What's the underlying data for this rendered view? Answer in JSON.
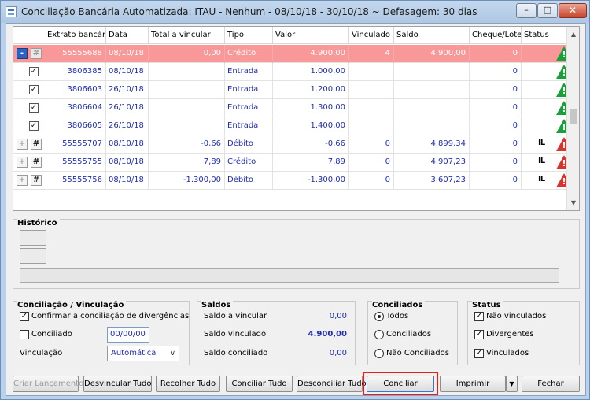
{
  "window": {
    "title": "Conciliação Bancária Automatizada: ITAU - Nenhum - 08/10/18 - 30/10/18 ~ Defasagem: 30 dias",
    "minimize": "–",
    "maximize": "□",
    "close": "✕"
  },
  "grid": {
    "columns": [
      "Extrato bancário",
      "Data",
      "Total a vincular",
      "Tipo",
      "Valor",
      "Vinculado",
      "Saldo",
      "Cheque/Lote",
      "Status"
    ],
    "rows": [
      {
        "extrato": "55555688",
        "data": "08/10/18",
        "total": "0,00",
        "tipo": "Crédito",
        "valor": "4.900,00",
        "vinculado": "4",
        "saldo": "4.900,00",
        "cheque": "0",
        "status": "ok"
      },
      {
        "extrato": "3806385",
        "data": "08/10/18",
        "total": "",
        "tipo": "Entrada",
        "valor": "1.000,00",
        "vinculado": "",
        "saldo": "",
        "cheque": "0",
        "status": "ok"
      },
      {
        "extrato": "3806603",
        "data": "26/10/18",
        "total": "",
        "tipo": "Entrada",
        "valor": "1.200,00",
        "vinculado": "",
        "saldo": "",
        "cheque": "0",
        "status": "ok"
      },
      {
        "extrato": "3806604",
        "data": "26/10/18",
        "total": "",
        "tipo": "Entrada",
        "valor": "1.300,00",
        "vinculado": "",
        "saldo": "",
        "cheque": "0",
        "status": "ok"
      },
      {
        "extrato": "3806605",
        "data": "26/10/18",
        "total": "",
        "tipo": "Entrada",
        "valor": "1.400,00",
        "vinculado": "",
        "saldo": "",
        "cheque": "0",
        "status": "ok"
      },
      {
        "extrato": "55555707",
        "data": "08/10/18",
        "total": "-0,66",
        "tipo": "Débito",
        "valor": "-0,66",
        "vinculado": "0",
        "saldo": "4.899,34",
        "cheque": "0",
        "status": "warn"
      },
      {
        "extrato": "55555755",
        "data": "08/10/18",
        "total": "7,89",
        "tipo": "Crédito",
        "valor": "7,89",
        "vinculado": "0",
        "saldo": "4.907,23",
        "cheque": "0",
        "status": "warn"
      },
      {
        "extrato": "55555756",
        "data": "08/10/18",
        "total": "-1.300,00",
        "tipo": "Débito",
        "valor": "-1.300,00",
        "vinculado": "0",
        "saldo": "3.607,23",
        "cheque": "0",
        "status": "warn"
      }
    ],
    "status_glyph": "!",
    "lock_glyph": "IL",
    "minus_glyph": "-",
    "plus_glyph": "+",
    "hash_glyph": "#",
    "check_glyph": "✓"
  },
  "historico": {
    "title": "Histórico"
  },
  "conciliacao": {
    "title": "Conciliação / Vinculação",
    "confirmar_label": "Confirmar a conciliação de divergências",
    "conciliado_label": "Conciliado",
    "conciliado_date": "00/00/00",
    "vinculacao_label": "Vinculação",
    "vinculacao_value": "Automática",
    "dropdown_glyph": "∨"
  },
  "saldos": {
    "title": "Saldos",
    "a_vincular_label": "Saldo a vincular",
    "a_vincular_value": "0,00",
    "vinculado_label": "Saldo vinculado",
    "vinculado_value": "4.900,00",
    "conciliado_label": "Saldo conciliado",
    "conciliado_value": "0,00"
  },
  "conciliados": {
    "title": "Conciliados",
    "todos": "Todos",
    "conciliados": "Conciliados",
    "nao_conciliados": "Não Conciliados"
  },
  "status_filter": {
    "title": "Status",
    "nao_vinculados": "Não vinculados",
    "divergentes": "Divergentes",
    "vinculados": "Vinculados"
  },
  "buttons": {
    "criar": "Criar Lançamento",
    "desvincular": "Desvincular Tudo",
    "recolher": "Recolher Tudo",
    "conciliar_tudo": "Conciliar Tudo",
    "desconciliar": "Desconciliar Tudo",
    "conciliar": "Conciliar",
    "imprimir": "Imprimir",
    "imprimir_dd": "▼",
    "fechar": "Fechar"
  },
  "colors": {
    "selected_row": "#f99898",
    "ok_status": "#1b9f3a",
    "warn_status": "#d5342f",
    "highlight": "#e0201c"
  }
}
